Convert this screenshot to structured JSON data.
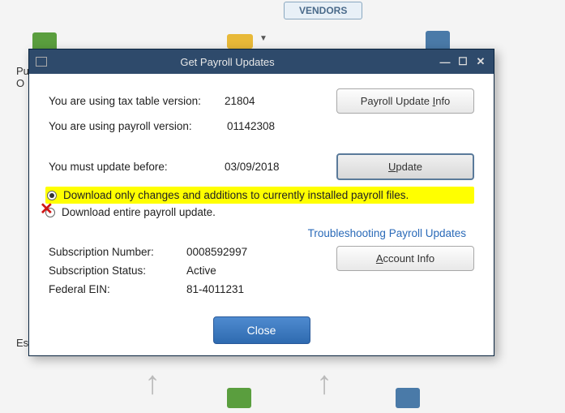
{
  "background": {
    "vendors": "VENDORS",
    "pu": "Pu",
    "o": "O",
    "es": "Es"
  },
  "dialog": {
    "title": "Get Payroll Updates",
    "tax_label": "You are using tax table version:",
    "tax_value": "21804",
    "payroll_label": "You are using payroll version:",
    "payroll_value": "01142308",
    "update_info_btn": "Payroll Update Info",
    "update_info_ul": "I",
    "must_update_label": "You must update before:",
    "must_update_value": "03/09/2018",
    "update_btn": "Update",
    "update_ul": "U",
    "radio1": "Download only changes and additions to currently installed payroll files.",
    "radio2": "Download entire payroll update.",
    "troubleshoot": "Troubleshooting Payroll Updates",
    "sub_num_label": "Subscription Number:",
    "sub_num_value": "0008592997",
    "sub_status_label": "Subscription Status:",
    "sub_status_value": "Active",
    "ein_label": "Federal EIN:",
    "ein_value": "81-4011231",
    "account_btn": "Account Info",
    "account_ul": "A",
    "close_btn": "Close"
  }
}
